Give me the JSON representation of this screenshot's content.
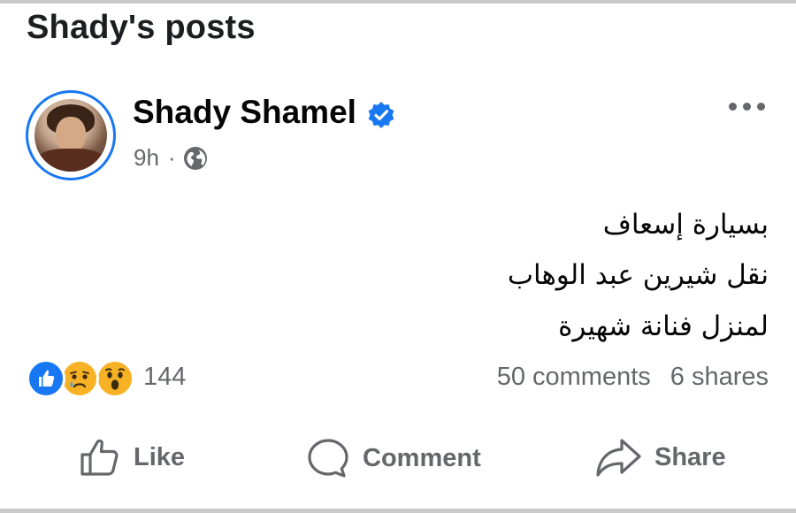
{
  "page": {
    "title": "Shady's posts"
  },
  "post": {
    "author": "Shady Shamel",
    "time": "9h",
    "separator": "·",
    "audience_icon": "globe-icon",
    "menu_icon": "more-options-icon",
    "body_lines": [
      "بسيارة إسعاف",
      "نقل شيرين عبد الوهاب",
      "لمنزل فنانة شهيرة"
    ],
    "reactions": {
      "icons": [
        "like-reaction-icon",
        "sad-reaction-icon",
        "wow-reaction-icon"
      ],
      "count": "144"
    },
    "comments": "50 comments",
    "shares": "6 shares"
  },
  "actions": {
    "like": "Like",
    "comment": "Comment",
    "share": "Share"
  },
  "colors": {
    "accent": "#1877f2",
    "secondary_text": "#65676b",
    "primary_text": "#050505",
    "reaction_yellow": "#f7b125"
  }
}
